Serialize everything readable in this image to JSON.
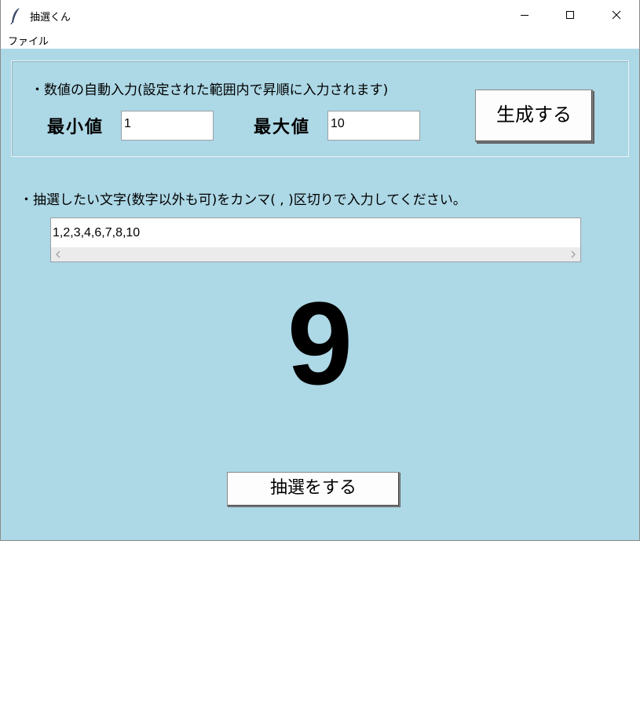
{
  "window": {
    "title": "抽選くん",
    "icon": "feather-icon",
    "controls": [
      "minimize-icon",
      "maximize-icon",
      "close-icon"
    ]
  },
  "menu": {
    "items": [
      {
        "label": "ファイル"
      }
    ]
  },
  "auto_input": {
    "label": "・数値の自動入力(設定された範囲内で昇順に入力されます)",
    "min_label": "最小値",
    "min_value": "1",
    "max_label": "最大値",
    "max_value": "10",
    "generate_button": "生成する"
  },
  "text_input": {
    "label": "・抽選したい文字(数字以外も可)をカンマ( , )区切りで入力してください。",
    "value": "1,2,3,4,6,7,8,10"
  },
  "result": {
    "value": "9"
  },
  "draw_button": {
    "label": "抽選をする"
  },
  "colors": {
    "background": "#add8e6",
    "titlebar": "#ffffff",
    "button": "#fdfdfd"
  }
}
